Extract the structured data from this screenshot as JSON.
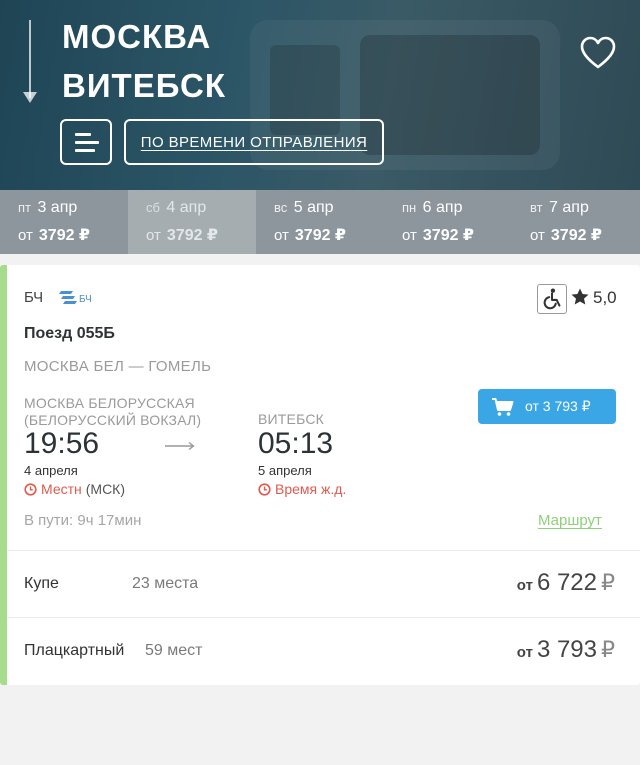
{
  "header": {
    "from_city": "МОСКВА",
    "to_city": "ВИТЕБСК",
    "sort_icon": "sort-lines-icon",
    "favorite_icon": "heart-icon",
    "order_label": "ПО ВРЕМЕНИ ОТПРАВЛЕНИЯ"
  },
  "dates": [
    {
      "dow": "пт",
      "date": "3 апр",
      "from": "от",
      "price": "3792 ₽",
      "selected": false
    },
    {
      "dow": "сб",
      "date": "4 апр",
      "from": "от",
      "price": "3792 ₽",
      "selected": true
    },
    {
      "dow": "вс",
      "date": "5 апр",
      "from": "от",
      "price": "3792 ₽",
      "selected": false
    },
    {
      "dow": "пн",
      "date": "6 апр",
      "from": "от",
      "price": "3792 ₽",
      "selected": false
    },
    {
      "dow": "вт",
      "date": "7 апр",
      "from": "от",
      "price": "3792 ₽",
      "selected": false
    }
  ],
  "train": {
    "carrier": "БЧ",
    "carrier_logo_text": "БЧ",
    "rating": "5,0",
    "number": "Поезд 055Б",
    "route": "МОСКВА БЕЛ — ГОМЕЛЬ",
    "departure": {
      "station": "МОСКВА БЕЛОРУССКАЯ (БЕЛОРУССКИЙ ВОКЗАЛ)",
      "time": "19:56",
      "date": "4 апреля",
      "tz": "Местн",
      "tz_extra": "(МСК)"
    },
    "arrival": {
      "station": "ВИТЕБСК",
      "time": "05:13",
      "date": "5 апреля",
      "tz": "Время ж.д."
    },
    "buy_label": "от 3 793 ₽",
    "duration": "В пути: 9ч 17мин",
    "route_link": "Маршрут",
    "classes": [
      {
        "name": "Купе",
        "seats": "23 места",
        "from": "от",
        "price": "6 722",
        "currency": "₽"
      },
      {
        "name": "Плацкартный",
        "seats": "59 мест",
        "from": "от",
        "price": "3 793",
        "currency": "₽"
      }
    ]
  },
  "colors": {
    "accent_blue": "#3aa6e5",
    "accent_green": "#8fd07a",
    "tz_red": "#e05a4e",
    "header_bg": "#2b5566"
  }
}
